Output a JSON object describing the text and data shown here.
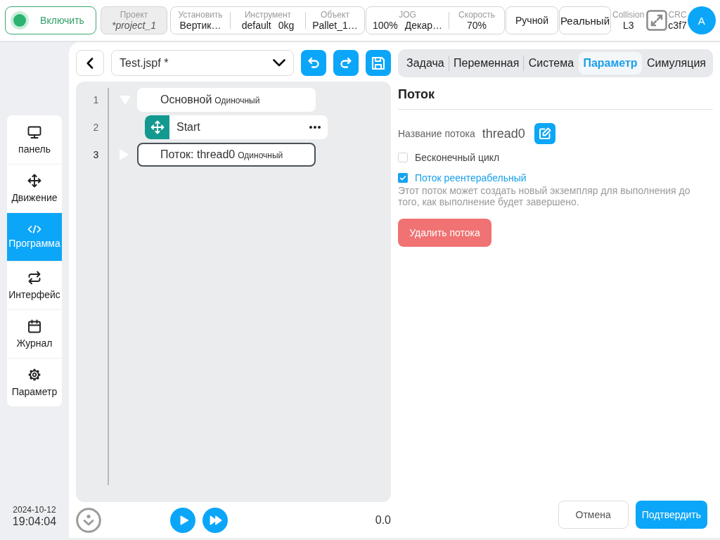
{
  "top_bar": {
    "power": {
      "label": "Включить"
    },
    "project": {
      "label": "Проект",
      "value": "*project_1"
    },
    "setup": [
      {
        "label": "Установить",
        "values": [
          "Вертик…"
        ]
      },
      {
        "label": "Инструмент",
        "values": [
          "default",
          "0kg"
        ]
      },
      {
        "label": "Объект",
        "values": [
          "Pallet_1…"
        ]
      }
    ],
    "motion": [
      {
        "label": "JOG",
        "values": [
          "100%",
          "Декар…"
        ]
      },
      {
        "label": "Скорость",
        "values": [
          "70%"
        ]
      }
    ],
    "modes": [
      "Ручной",
      "Реальный"
    ],
    "collision": {
      "label": "Collision",
      "value": "L3"
    },
    "crc": {
      "label": "CRC",
      "value": "c3f7"
    },
    "avatar": "A"
  },
  "sidebar": {
    "items": [
      {
        "label": "панель",
        "selected": false
      },
      {
        "label": "Движение",
        "selected": false
      },
      {
        "label": "Программа",
        "selected": true
      },
      {
        "label": "Интерфейс",
        "selected": false
      },
      {
        "label": "Журнал",
        "selected": false
      },
      {
        "label": "Параметр",
        "selected": false
      }
    ],
    "date": "2024-10-12",
    "time": "19:04:04"
  },
  "editor": {
    "file": "Test.jspf *",
    "nodes": [
      {
        "kind": "block",
        "line": "1",
        "title": "Основной",
        "mode": "Одиночный",
        "expanded": true,
        "selected": false,
        "children": [
          {
            "kind": "command",
            "line": "2",
            "title": "Start",
            "selected": false
          }
        ]
      },
      {
        "kind": "block",
        "line": "3",
        "title": "Поток: thread0",
        "mode": "Одиночный",
        "expanded": false,
        "selected": true
      }
    ],
    "counter": "0.0"
  },
  "settings": {
    "tabs": [
      {
        "label": "Задача",
        "selected": false
      },
      {
        "label": "Переменная",
        "selected": false
      },
      {
        "label": "Система",
        "selected": false
      },
      {
        "label": "Параметр",
        "selected": true
      },
      {
        "label": "Симуляция",
        "selected": false
      }
    ],
    "heading": "Поток",
    "name_label": "Название потока",
    "name_value": "thread0",
    "options": [
      {
        "label": "Бесконечный цикл",
        "checked": false
      },
      {
        "label": "Поток реентерабельный",
        "checked": true
      }
    ],
    "description": "Этот поток может создать новый экземпляр для выполнения до того, как выполнение будет завершено.",
    "delete_button": "Удалить потока"
  },
  "footer": {
    "cancel": "Отмена",
    "confirm": "Подтвердить"
  }
}
